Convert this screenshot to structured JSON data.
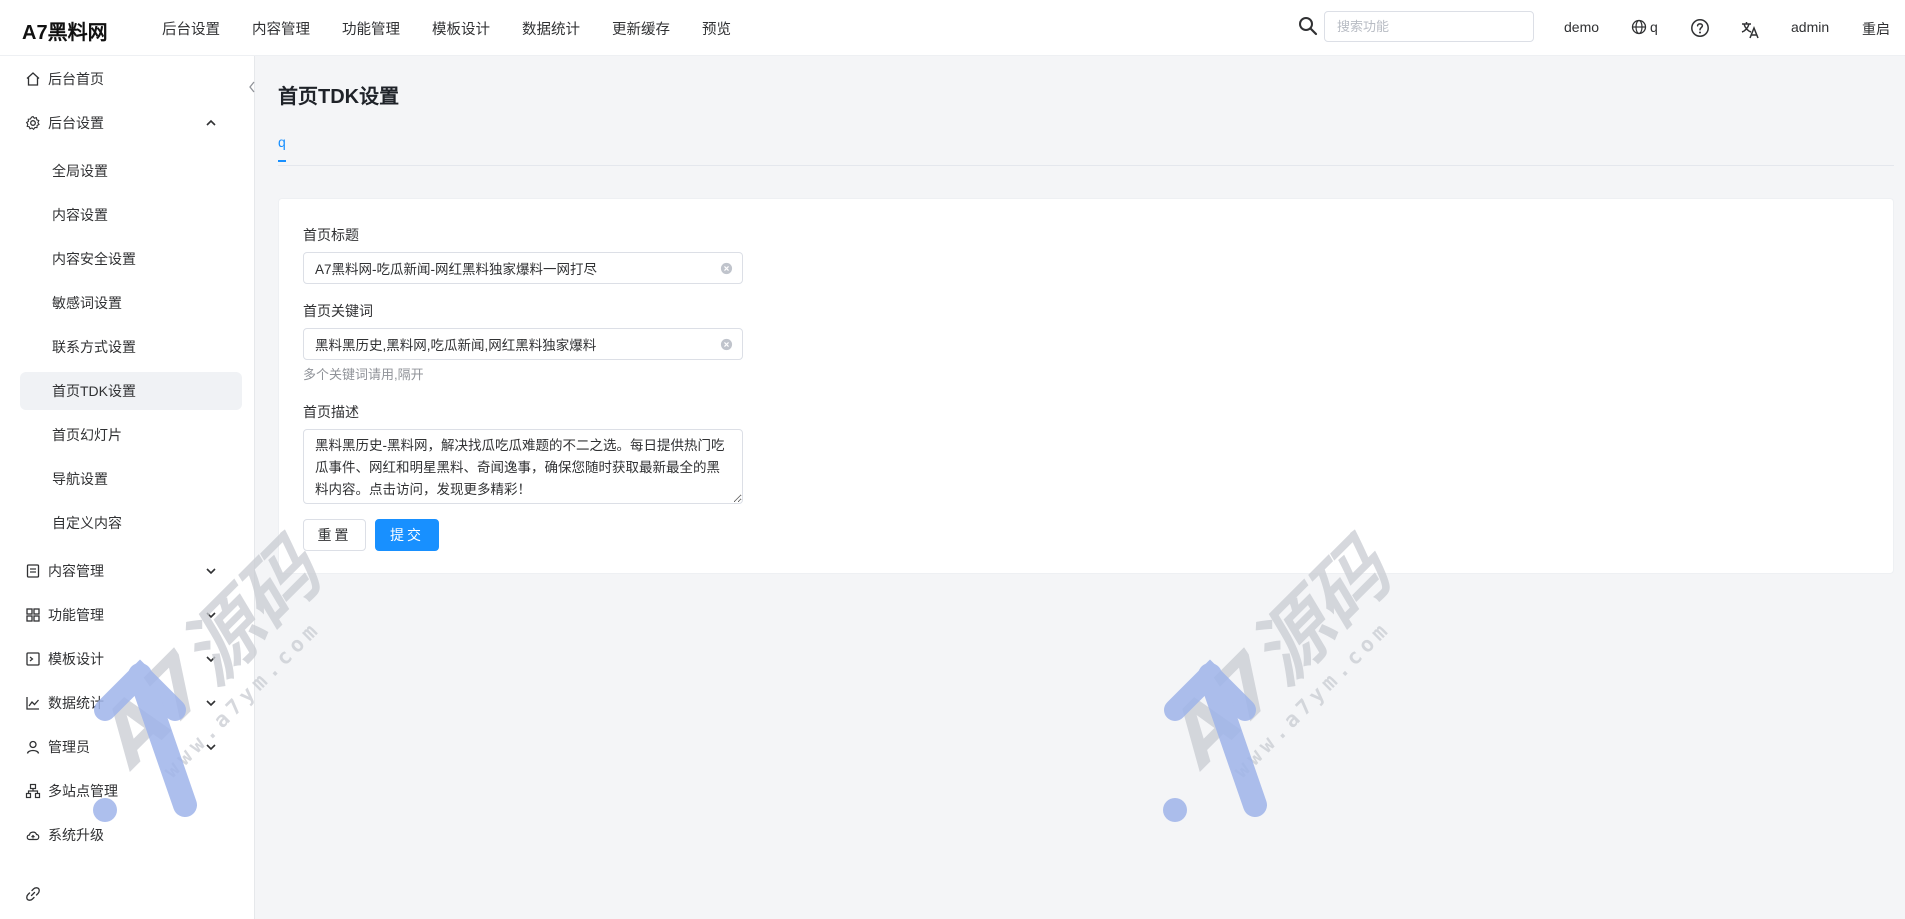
{
  "brand": {
    "logo": "A7黑料网"
  },
  "topnav": [
    "后台设置",
    "内容管理",
    "功能管理",
    "模板设计",
    "数据统计",
    "更新缓存",
    "预览"
  ],
  "header": {
    "search_placeholder": "搜索功能",
    "site": "demo",
    "language": "q",
    "user": "admin",
    "restart": "重启"
  },
  "sidebar": {
    "home": "后台首页",
    "settings": "后台设置",
    "settings_children": [
      "全局设置",
      "内容设置",
      "内容安全设置",
      "敏感词设置",
      "联系方式设置",
      "首页TDK设置",
      "首页幻灯片",
      "导航设置",
      "自定义内容"
    ],
    "active_child": "首页TDK设置",
    "content_mgmt": "内容管理",
    "function_mgmt": "功能管理",
    "template": "模板设计",
    "stats": "数据统计",
    "admin": "管理员",
    "multisite": "多站点管理",
    "upgrade": "系统升级"
  },
  "page": {
    "title": "首页TDK设置",
    "tab": "q",
    "form": {
      "title_label": "首页标题",
      "title_value": "A7黑料网-吃瓜新闻-网红黑料独家爆料一网打尽",
      "keywords_label": "首页关键词",
      "keywords_value": "黑料黑历史,黑料网,吃瓜新闻,网红黑料独家爆料",
      "keywords_help": "多个关键词请用,隔开",
      "desc_label": "首页描述",
      "desc_value": "黑料黑历史-黑料网，解决找瓜吃瓜难题的不二之选。每日提供热门吃瓜事件、网红和明星黑料、奇闻逸事，确保您随时获取最新最全的黑料内容。点击访问，发现更多精彩！",
      "reset_label": "重置",
      "submit_label": "提交"
    }
  },
  "watermark": {
    "text": "A7源码",
    "url": "www.a7ym.com"
  },
  "colors": {
    "accent": "#1890ff",
    "watermark": "#9fb4ea"
  },
  "icons": {
    "search": "search-icon",
    "globe": "globe-icon",
    "help": "help-icon",
    "translate": "translate-icon",
    "home": "home-icon",
    "gear": "gear-icon",
    "document": "document-icon",
    "grid": "grid-icon",
    "template": "template-icon",
    "chart": "chart-icon",
    "user": "user-icon",
    "sitemap": "sitemap-icon",
    "upgrade": "cloud-upgrade-icon",
    "link": "link-icon",
    "clear": "clear-icon"
  }
}
